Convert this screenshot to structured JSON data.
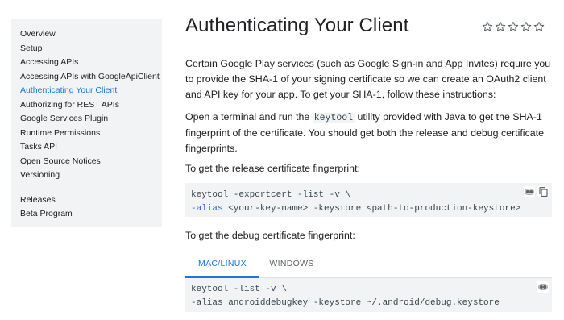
{
  "sidebar": {
    "items": [
      {
        "label": "Overview"
      },
      {
        "label": "Setup"
      },
      {
        "label": "Accessing APIs"
      },
      {
        "label": "Accessing APIs with GoogleApiClient"
      },
      {
        "label": "Authenticating Your Client",
        "active": true
      },
      {
        "label": "Authorizing for REST APIs"
      },
      {
        "label": "Google Services Plugin"
      },
      {
        "label": "Runtime Permissions"
      },
      {
        "label": "Tasks API"
      },
      {
        "label": "Open Source Notices"
      },
      {
        "label": "Versioning"
      }
    ],
    "secondary_items": [
      {
        "label": "Releases"
      },
      {
        "label": "Beta Program"
      }
    ]
  },
  "page": {
    "title": "Authenticating Your Client",
    "rating": {
      "stars": 5,
      "filled": 0
    },
    "intro": "Certain Google Play services (such as Google Sign-in and App Invites) require you to provide the SHA-1 of your signing certificate so we can create an OAuth2 client and API key for your app. To get your SHA-1, follow these instructions:",
    "step_before": "Open a terminal and run the ",
    "step_code": "keytool",
    "step_after": " utility provided with Java to get the SHA-1 fingerprint of the certificate. You should get both the release and debug certificate fingerprints.",
    "release_label": "To get the release certificate fingerprint:",
    "release_code": {
      "line1": "keytool -exportcert -list -v \\",
      "line2_kw": "-alias",
      "line2_rest": " <your-key-name> -keystore <path-to-production-keystore>"
    },
    "debug_label": "To get the debug certificate fingerprint:",
    "tabs": [
      {
        "label": "MAC/LINUX",
        "active": true
      },
      {
        "label": "WINDOWS",
        "active": false
      }
    ],
    "debug_code": {
      "line1": "keytool -list -v \\",
      "line2": "-alias androiddebugkey -keystore ~/.android/debug.keystore"
    }
  },
  "colors": {
    "accent": "#1a73e8",
    "sidebar_bg": "#f1f3f4",
    "code_bg": "#f1f3f4"
  },
  "icons": {
    "star": "star-outline-icon",
    "theme_toggle": "dark-mode-toggle-icon",
    "copy": "copy-icon"
  }
}
